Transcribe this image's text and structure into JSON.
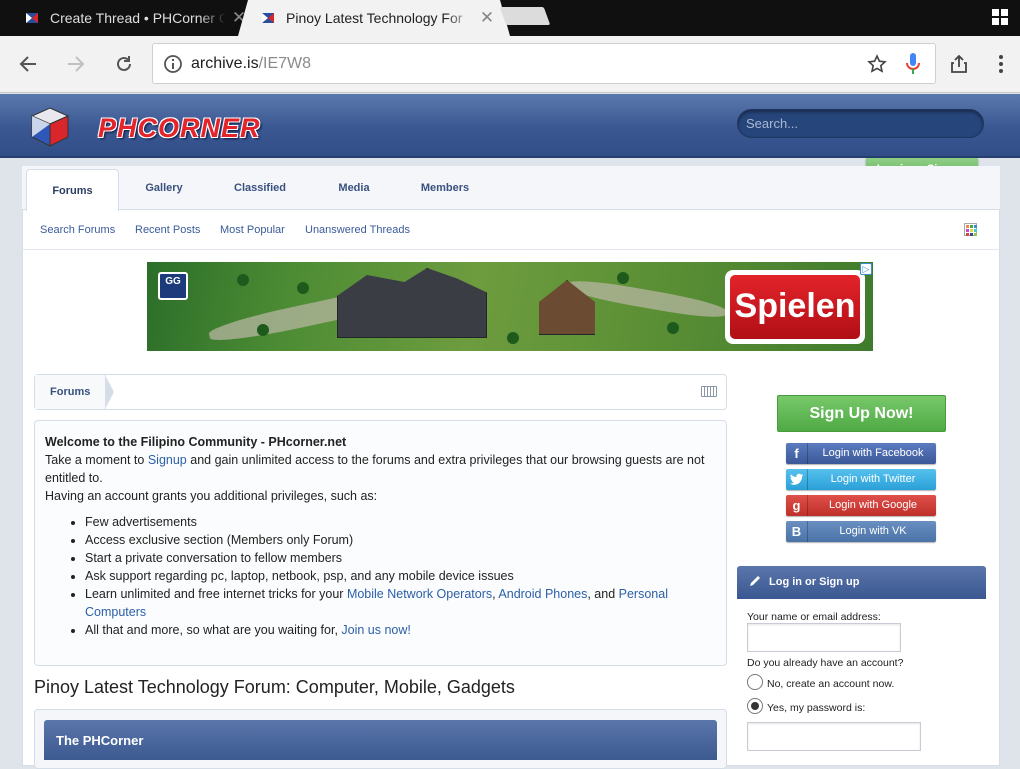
{
  "browser": {
    "tabs": [
      {
        "title": "Create Thread • PHCorner C"
      },
      {
        "title": "Pinoy Latest Technology For"
      }
    ],
    "url_host": "archive.is",
    "url_path": "/IE7W8"
  },
  "site": {
    "logo_text": "PHCORNER",
    "search_placeholder": "Search...",
    "login_signup": "Log in or Sign up",
    "nav_tabs": [
      "Forums",
      "Gallery",
      "Classified",
      "Media",
      "Members"
    ],
    "sub_links": [
      "Search Forums",
      "Recent Posts",
      "Most Popular",
      "Unanswered Threads"
    ]
  },
  "ad": {
    "logo": "GG",
    "cta": "Spielen"
  },
  "breadcrumb": "Forums",
  "notice": {
    "title": "Welcome to the Filipino Community - PHcorner.net",
    "line1_a": "Take a moment to ",
    "line1_link": "Signup",
    "line1_b": " and gain unlimited access to the forums and extra privileges that our browsing guests are not entitled to.",
    "line2": "Having an account grants you additional privileges, such as:",
    "items": [
      "Few advertisements",
      "Access exclusive section (Members only Forum)",
      "Start a private conversation to fellow members",
      "Ask support regarding pc, laptop, netbook, psp, and any mobile device issues"
    ],
    "item5_a": "Learn unlimited and free internet tricks for your ",
    "item5_link1": "Mobile Network Operators",
    "item5_sep1": ", ",
    "item5_link2": "Android Phones",
    "item5_sep2": ", and ",
    "item5_link3": "Personal Computers",
    "item6_a": "All that and more, so what are you waiting for, ",
    "item6_link": "Join us now!"
  },
  "forum_title": "Pinoy Latest Technology Forum: Computer, Mobile, Gadgets",
  "category_title": "The PHCorner",
  "sidebar": {
    "signup": "Sign Up Now!",
    "social": [
      {
        "icon": "f",
        "label": "Login with Facebook"
      },
      {
        "icon": "t",
        "label": "Login with Twitter"
      },
      {
        "icon": "g",
        "label": "Login with Google"
      },
      {
        "icon": "B",
        "label": "Login with VK"
      }
    ],
    "login_panel_title": "Log in or Sign up",
    "name_label": "Your name or email address:",
    "account_question": "Do you already have an account?",
    "radio_no": "No, create an account now.",
    "radio_yes": "Yes, my password is:"
  },
  "colors": {
    "header_blue": "#3a5791",
    "green": "#5fae59",
    "link": "#2b5fa8"
  }
}
